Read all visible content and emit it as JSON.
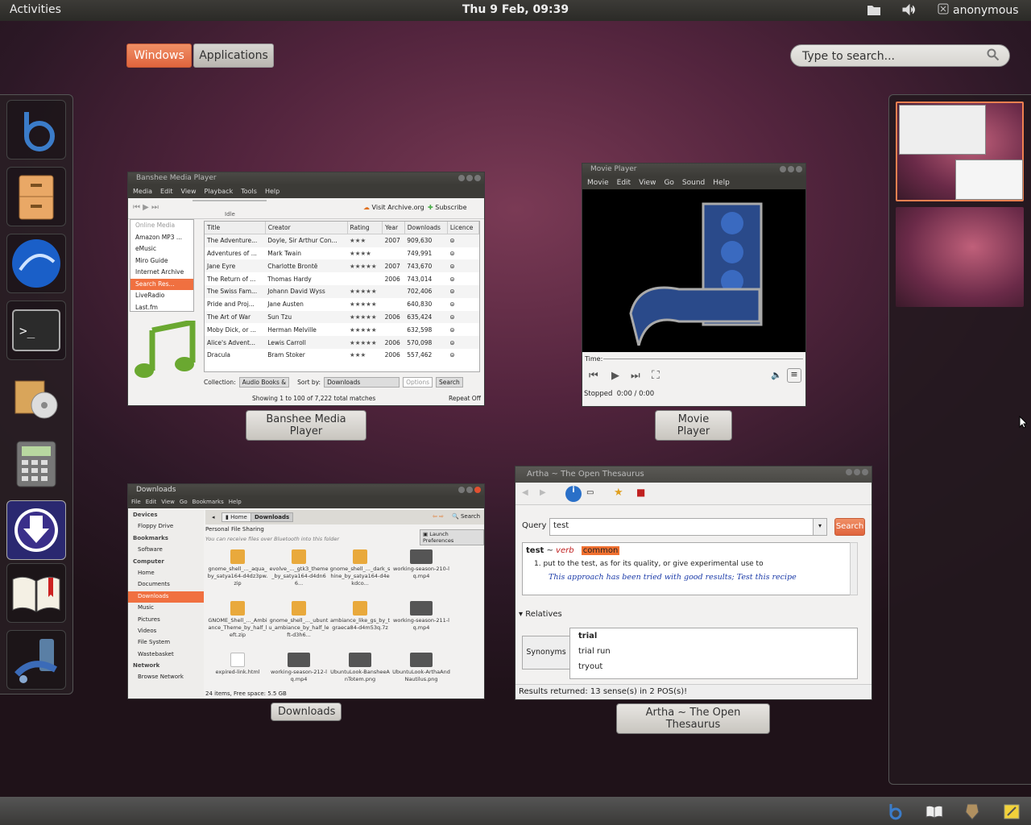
{
  "topbar": {
    "activities": "Activities",
    "clock": "Thu  9 Feb, 09:39",
    "user": "anonymous"
  },
  "overview": {
    "windows_label": "Windows",
    "applications_label": "Applications",
    "search_placeholder": "Type to search..."
  },
  "dash": [
    "banshee-icon",
    "file-cabinet-icon",
    "seamonkey-icon",
    "terminal-icon",
    "software-installer-icon",
    "calculator-icon",
    "download-manager-icon",
    "dictionary-icon",
    "network-icon"
  ],
  "banshee": {
    "title": "Banshee Media Player",
    "menus": [
      "Media",
      "Edit",
      "View",
      "Playback",
      "Tools",
      "Help"
    ],
    "status_idle": "Idle",
    "visit": "Visit Archive.org",
    "subscribe": "Subscribe",
    "sidebar": [
      "Online Media",
      "Amazon MP3 ...",
      "eMusic",
      "Miro Guide",
      "Internet Archive",
      "Search Res...",
      "LiveRadio",
      "Last.fm"
    ],
    "columns": [
      "Title",
      "Creator",
      "Rating",
      "Year",
      "Downloads",
      "Licence"
    ],
    "rows": [
      [
        "The Adventure...",
        "Doyle, Sir Arthur Con...",
        "★★★",
        "2007",
        "909,630"
      ],
      [
        "Adventures of ...",
        "Mark Twain",
        "★★★★",
        "",
        "749,991"
      ],
      [
        "Jane Eyre",
        "Charlotte Brontë",
        "★★★★★",
        "2007",
        "743,670"
      ],
      [
        "The Return of ...",
        "Thomas Hardy",
        "",
        "2006",
        "743,014"
      ],
      [
        "The Swiss Fam...",
        "Johann David Wyss",
        "★★★★★",
        "",
        "702,406"
      ],
      [
        "Pride and Proj...",
        "Jane Austen",
        "★★★★★",
        "",
        "640,830"
      ],
      [
        "The Art of War",
        "Sun Tzu",
        "★★★★★",
        "2006",
        "635,424"
      ],
      [
        "Moby Dick, or ...",
        "Herman Melville",
        "★★★★★",
        "",
        "632,598"
      ],
      [
        "Alice's Advent...",
        "Lewis Carroll",
        "★★★★★",
        "2006",
        "570,098"
      ],
      [
        "Dracula",
        "Bram Stoker",
        "★★★",
        "2006",
        "557,462"
      ]
    ],
    "collection_label": "Collection:",
    "collection_value": "Audio Books &",
    "sort_label": "Sort by:",
    "sort_value": "Downloads",
    "options": "Options",
    "search": "Search",
    "status": "Showing 1 to 100 of 7,222 total matches",
    "repeat": "Repeat Off",
    "caption": "Banshee Media Player"
  },
  "movie": {
    "title": "Movie Player",
    "menus": [
      "Movie",
      "Edit",
      "View",
      "Go",
      "Sound",
      "Help"
    ],
    "time_label": "Time:",
    "status": "Stopped",
    "position": "0:00 / 0:00",
    "caption": "Movie Player"
  },
  "downloads": {
    "title": "Downloads",
    "menus": [
      "File",
      "Edit",
      "View",
      "Go",
      "Bookmarks",
      "Help"
    ],
    "home": "Home",
    "current": "Downloads",
    "search": "Search",
    "sharing": "Personal File Sharing",
    "sharing_note": "You can receive files over Bluetooth into this folder",
    "launch": "Launch Preferences",
    "side": [
      {
        "t": "Devices",
        "h": true
      },
      {
        "t": "Floppy Drive"
      },
      {
        "t": "Bookmarks",
        "h": true
      },
      {
        "t": "Software"
      },
      {
        "t": "Computer",
        "h": true
      },
      {
        "t": "Home"
      },
      {
        "t": "Documents"
      },
      {
        "t": "Downloads",
        "sel": true
      },
      {
        "t": "Music"
      },
      {
        "t": "Pictures"
      },
      {
        "t": "Videos"
      },
      {
        "t": "File System"
      },
      {
        "t": "Wastebasket"
      },
      {
        "t": "Network",
        "h": true
      },
      {
        "t": "Browse Network"
      }
    ],
    "files": [
      "gnome_shell_..._aqua_by_satya164-d4dz3pw.zip",
      "evolve_..._gtk3_theme_by_satya164-d4dn66...",
      "gnome_shell_..._dark_shine_by_satya164-d4ekdco...",
      "working-season-210-lq.mp4",
      "GNOME_Shell_..._Ambiance_Theme_by_half_left.zip",
      "gnome_shell_..._ubuntu_ambiance_by_half_left-d3h6...",
      "ambiance_like_gs_by_tgraeca84-d4m53q.7z",
      "working-season-211-lq.mp4",
      "expired-link.html",
      "working-season-212-lq.mp4",
      "UbuntuLook-BansheeAnTotem.png",
      "UbuntuLook-ArthaAndNautilus.png"
    ],
    "status": "24 items, Free space: 5.5 GB",
    "caption": "Downloads"
  },
  "artha": {
    "title": "Artha ~ The Open Thesaurus",
    "query_label": "Query",
    "query": "test",
    "search": "Search",
    "word": "test",
    "pos": "verb",
    "tag": "common",
    "def": "put to the test, as for its quality, or give experimental use to",
    "example": "This approach has been tried with good results; Test this recipe",
    "relatives": "Relatives",
    "synonyms": "Synonyms",
    "syn_list": [
      "trial",
      "trial run",
      "tryout"
    ],
    "status": "Results returned: 13 sense(s) in 2 POS(s)!",
    "caption": "Artha ~ The Open Thesaurus"
  },
  "tray": [
    "banshee-tray-icon",
    "dictionary-tray-icon",
    "network-tray-icon",
    "notes-tray-icon"
  ]
}
